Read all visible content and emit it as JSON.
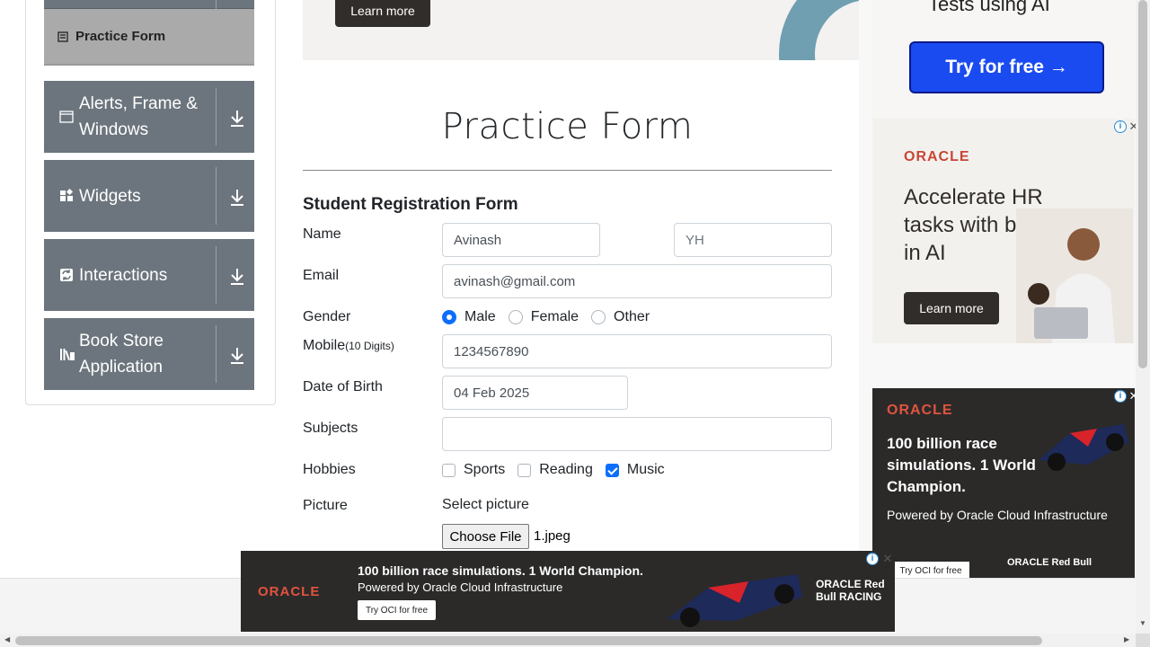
{
  "sidebar": {
    "active_item": {
      "label": "Practice Form",
      "icon": "form-icon"
    },
    "groups": [
      {
        "label": "Alerts, Frame & Windows",
        "icon": "window-icon"
      },
      {
        "label": "Widgets",
        "icon": "widgets-icon"
      },
      {
        "label": "Interactions",
        "icon": "interactions-icon"
      },
      {
        "label": "Book Store Application",
        "icon": "book-store-icon"
      }
    ]
  },
  "top_banner": {
    "button": "Learn more"
  },
  "form": {
    "page_title": "Practice Form",
    "heading": "Student Registration Form",
    "labels": {
      "name": "Name",
      "email": "Email",
      "gender": "Gender",
      "mobile": "Mobile",
      "mobile_hint": "(10 Digits)",
      "dob": "Date of Birth",
      "subjects": "Subjects",
      "hobbies": "Hobbies",
      "picture": "Picture"
    },
    "first_name": "Avinash",
    "last_name": "YH",
    "email_value": "avinash@gmail.com",
    "gender_options": [
      "Male",
      "Female",
      "Other"
    ],
    "gender_selected": "Male",
    "mobile_value": "1234567890",
    "dob_value": "04 Feb 2025",
    "subjects_value": "",
    "hobby_options": [
      "Sports",
      "Reading",
      "Music"
    ],
    "hobbies_checked": [
      "Music"
    ],
    "select_picture": "Select picture",
    "choose_file": "Choose File",
    "file_name": "1.jpeg"
  },
  "ads": {
    "top_right": {
      "partial_text": "Tests using AI",
      "button": "Try for free →"
    },
    "hr": {
      "brand": "ORACLE",
      "headline": "Accelerate HR tasks with built-in AI",
      "button": "Learn more"
    },
    "f1_right": {
      "brand": "ORACLE",
      "headline": "100 billion race simulations. 1 World Champion.",
      "sub": "Powered by Oracle Cloud Infrastructure",
      "button": "Try OCI for free",
      "partner": "ORACLE Red Bull"
    },
    "f1_bottom": {
      "brand": "ORACLE",
      "headline": "100 billion race simulations. 1 World Champion.",
      "sub": "Powered by Oracle Cloud Infrastructure",
      "button": "Try OCI for free",
      "partner": "ORACLE Red Bull RACING"
    }
  },
  "colors": {
    "primary": "#0d6efd",
    "sidebar": "#6c757d",
    "active": "#aaaaaa",
    "oracle_red": "#c74634"
  }
}
